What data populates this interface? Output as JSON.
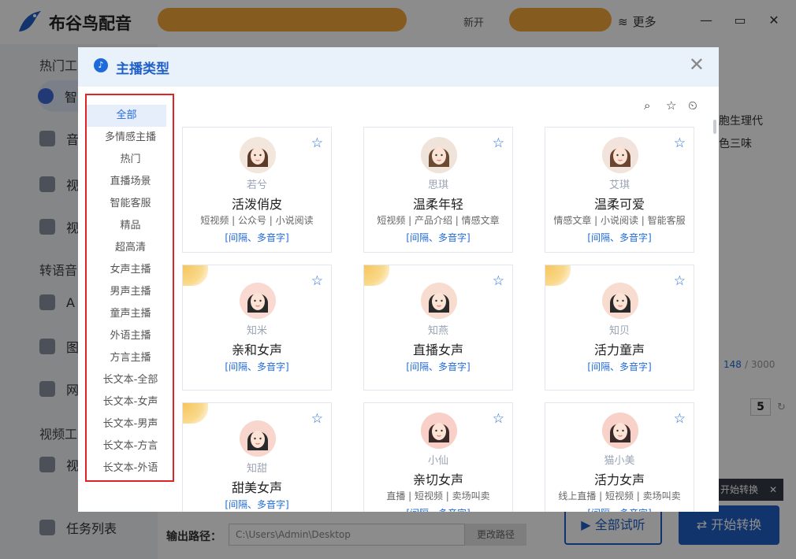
{
  "app": {
    "name": "布谷鸟配音",
    "more_label": "更多",
    "promo_text": "新开"
  },
  "sidebar": {
    "sections": [
      {
        "title": "热门工"
      },
      {
        "title": "转语音"
      },
      {
        "title": "视频工"
      }
    ],
    "items": [
      {
        "label": "智"
      },
      {
        "label": "音"
      },
      {
        "label": "视"
      },
      {
        "label": "视"
      },
      {
        "label": "A"
      },
      {
        "label": "图"
      },
      {
        "label": "网"
      },
      {
        "label": "视"
      }
    ],
    "task_list_label": "任务列表"
  },
  "background": {
    "text1": "胞生理代",
    "text2": "色三味",
    "char_count": "148",
    "char_max": "/ 3000",
    "speed_value": "5"
  },
  "bottom": {
    "output_label": "输出路径：",
    "output_path": "C:\\Users\\Admin\\Desktop",
    "change_path_label": "更改路径",
    "preview_all_label": "全部试听",
    "start_label": "开始转换",
    "tooltip": "开始转换"
  },
  "dialog": {
    "title": "主播类型",
    "categories": [
      "全部",
      "多情感主播",
      "热门",
      "直播场景",
      "智能客服",
      "精品",
      "超高清",
      "女声主播",
      "男声主播",
      "童声主播",
      "外语主播",
      "方言主播",
      "长文本-全部",
      "长文本-女声",
      "长文本-男声",
      "长文本-方言",
      "长文本-外语"
    ],
    "active_category": "全部",
    "cards": [
      {
        "nick": "若兮",
        "type": "活泼俏皮",
        "tags": "短视频 | 公众号 | 小说阅读",
        "feature": "[间隔、多音字]",
        "badge": false
      },
      {
        "nick": "思琪",
        "type": "温柔年轻",
        "tags": "短视频 | 产品介绍 | 情感文章",
        "feature": "[间隔、多音字]",
        "badge": false
      },
      {
        "nick": "艾琪",
        "type": "温柔可爱",
        "tags": "情感文章 | 小说阅读 | 智能客服",
        "feature": "[间隔、多音字]",
        "badge": false
      },
      {
        "nick": "知米",
        "type": "亲和女声",
        "tags": "",
        "feature": "[间隔、多音字]",
        "badge": true
      },
      {
        "nick": "知燕",
        "type": "直播女声",
        "tags": "",
        "feature": "[间隔、多音字]",
        "badge": true
      },
      {
        "nick": "知贝",
        "type": "活力童声",
        "tags": "",
        "feature": "[间隔、多音字]",
        "badge": true
      },
      {
        "nick": "知甜",
        "type": "甜美女声",
        "tags": "",
        "feature": "[间隔、多音字]",
        "badge": true
      },
      {
        "nick": "小仙",
        "type": "亲切女声",
        "tags": "直播 | 短视频 | 卖场叫卖",
        "feature": "[间隔、多音字]",
        "badge": false
      },
      {
        "nick": "猫小美",
        "type": "活力女声",
        "tags": "线上直播 | 短视频 | 卖场叫卖",
        "feature": "[间隔、多音字]",
        "badge": false
      }
    ]
  }
}
